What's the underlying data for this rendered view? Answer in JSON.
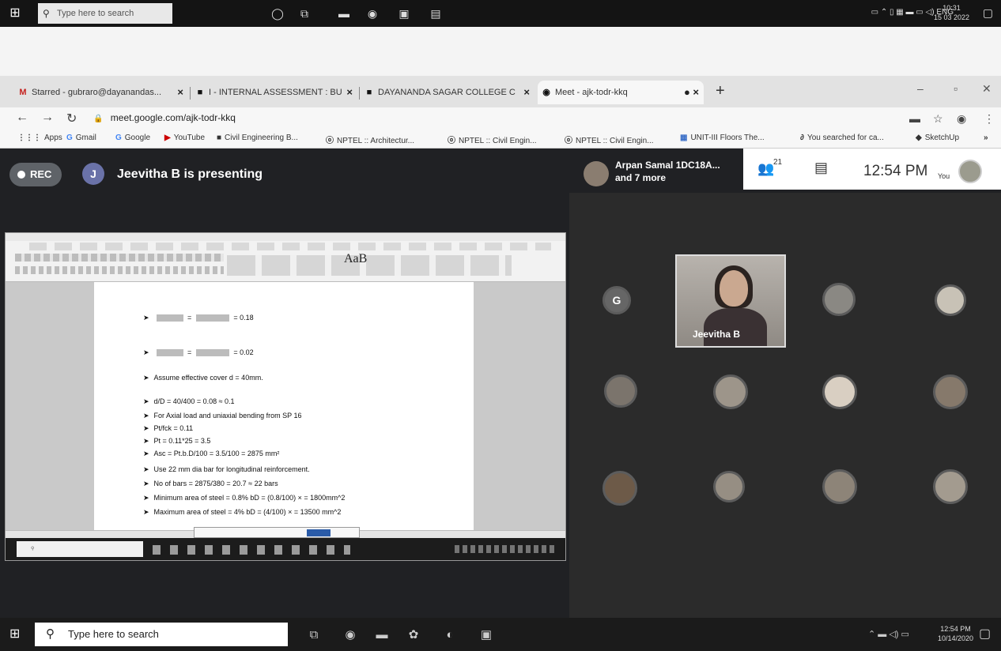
{
  "outer_taskbar": {
    "search_placeholder": "Type here to search",
    "tray_lang": "ENG",
    "clock_time": "10:31",
    "clock_date": "15 03 2022"
  },
  "browser": {
    "tabs": [
      {
        "icon": "M",
        "label": "Starred - gubraro@dayanandas..."
      },
      {
        "icon": "■",
        "label": "I - INTERNAL ASSESSMENT : BU"
      },
      {
        "icon": "■",
        "label": "DAYANANDA SAGAR COLLEGE C"
      },
      {
        "icon": "◉",
        "label": "Meet - ajk-todr-kkq"
      }
    ],
    "url": "meet.google.com/ajk-todr-kkq",
    "bookmarks": [
      {
        "icon": "⋮⋮⋮",
        "label": "Apps"
      },
      {
        "icon": "G",
        "label": "Gmail"
      },
      {
        "icon": "G",
        "label": "Google"
      },
      {
        "icon": "▶",
        "label": "YouTube"
      },
      {
        "icon": "■",
        "label": "Civil Engineering B..."
      },
      {
        "icon": "ⓞ",
        "label": "NPTEL :: Architectur..."
      },
      {
        "icon": "ⓞ",
        "label": "NPTEL :: Civil Engin..."
      },
      {
        "icon": "ⓞ",
        "label": "NPTEL :: Civil Engin..."
      },
      {
        "icon": "▦",
        "label": "UNIT-III Floors The..."
      },
      {
        "icon": "∂",
        "label": "You searched for ca..."
      },
      {
        "icon": "◆",
        "label": "SketchUp"
      },
      {
        "icon": "»",
        "label": ""
      }
    ]
  },
  "meet": {
    "rec_label": "REC",
    "presenter_initial": "J",
    "presenting_text": "Jeevitha B is presenting",
    "participants_name": "Arpan Samal 1DC18A...",
    "participants_more": "and 7 more",
    "people_count": "21",
    "clock": "12:54 PM",
    "you_label": "You",
    "featured_name": "Jeevitha B",
    "tiles": [
      {
        "initial": "G"
      }
    ]
  },
  "shared_doc": {
    "font_sample": "AaB",
    "lines": [
      {
        "text": "= 0.18"
      },
      {
        "text": "= 0.02"
      },
      {
        "text": "Assume effective cover d = 40mm."
      },
      {
        "text": "d/D = 40/400 = 0.08 ≈ 0.1"
      },
      {
        "text": "For Axial load and uniaxial bending from SP 16"
      },
      {
        "text": "Pt/fck = 0.11"
      },
      {
        "text": "Pt = 0.11*25 = 3.5"
      },
      {
        "text": "Asc = Pt.b.D/100 = 3.5/100 = 2875 mm²"
      },
      {
        "text": "Use 22 mm dia bar for longitudinal reinforcement."
      },
      {
        "text": "No of bars = 2875/380 = 20.7 ≈ 22 bars"
      },
      {
        "text": "Minimum area of steel = 0.8% bD = (0.8/100) ×      = 1800mm^2"
      },
      {
        "text": "Maximum area of steel = 4% bD = (4/100) ×      = 13500 mm^2"
      }
    ]
  },
  "taskbar": {
    "search_placeholder": "Type here to search",
    "clock_time": "12:54 PM",
    "clock_date": "10/14/2020"
  }
}
